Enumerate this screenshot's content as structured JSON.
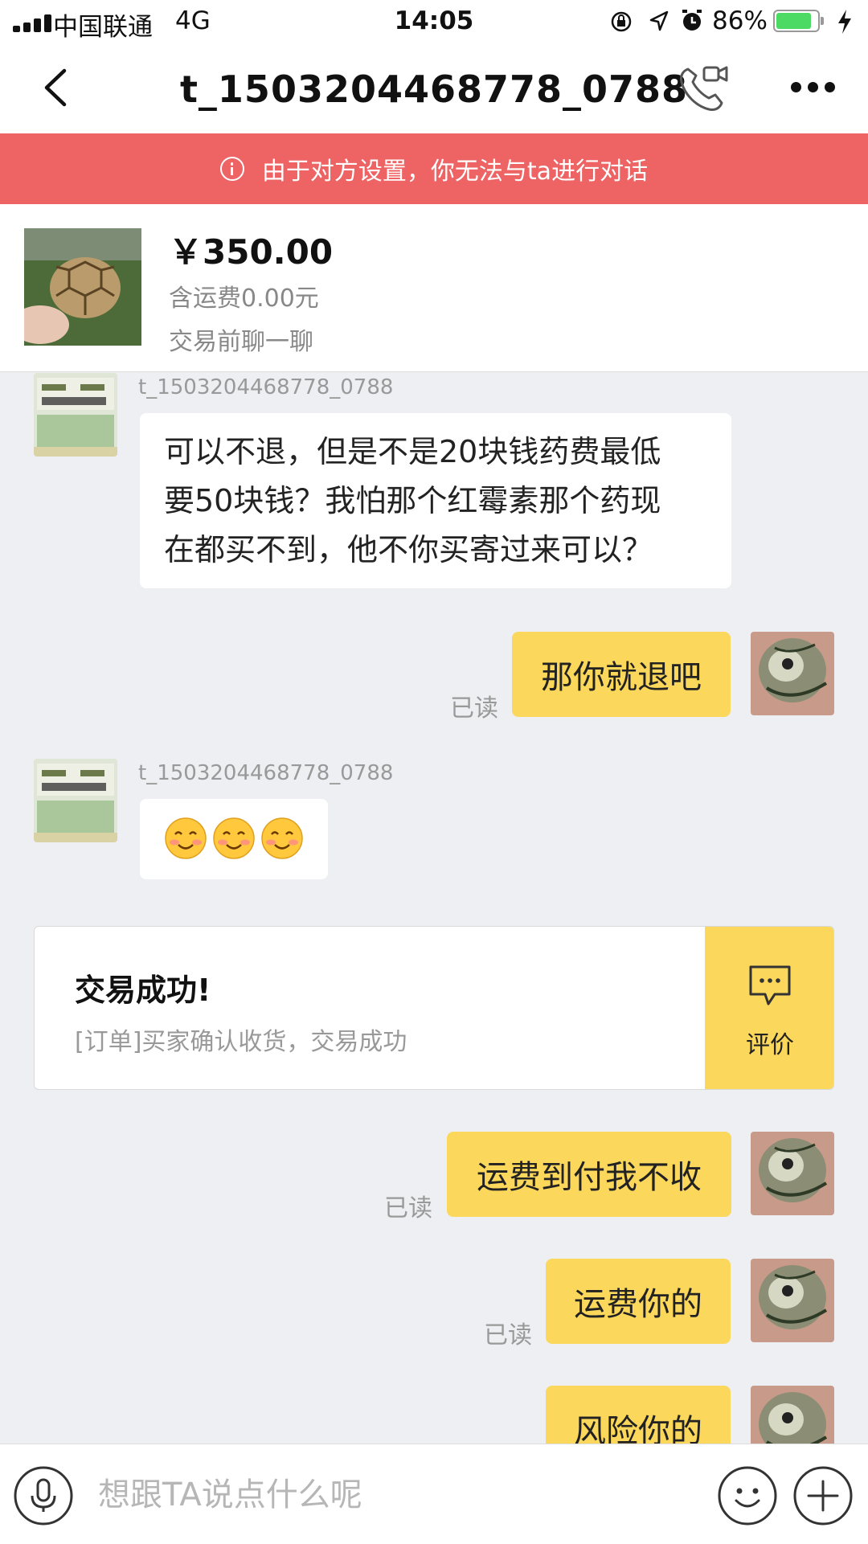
{
  "status_bar": {
    "carrier": "中国联通",
    "network": "4G",
    "time": "14:05",
    "battery_percent": "86%",
    "battery_level": 0.86,
    "battery_color": "#4cd964"
  },
  "nav": {
    "title": "t_1503204468778_0788",
    "icons": [
      "back-chevron-icon",
      "phone-video-call-icon",
      "more-icon"
    ]
  },
  "banner": {
    "text": "由于对方设置，你无法与ta进行对话",
    "color": "#ee6363"
  },
  "product": {
    "price": "￥350.00",
    "shipping": "含运费0.00元",
    "tag": "交易前聊一聊"
  },
  "messages": [
    {
      "direction": "in",
      "sender": "t_1503204468778_0788",
      "lines": [
        "可以不退，但是不是20块钱药费最低",
        "要50块钱？我怕那个红霉素那个药现",
        "在都买不到，他不你买寄过来可以？"
      ]
    },
    {
      "direction": "out",
      "text": "那你就退吧",
      "read": "已读"
    },
    {
      "direction": "in",
      "sender": "t_1503204468778_0788",
      "emoji": [
        "smiling-face-emoji",
        "smiling-face-emoji",
        "smiling-face-emoji"
      ]
    },
    {
      "direction": "out",
      "text": "运费到付我不收",
      "read": "已读"
    },
    {
      "direction": "out",
      "text": "运费你的",
      "read": "已读"
    },
    {
      "direction": "out",
      "text": "风险你的"
    }
  ],
  "order_card": {
    "title": "交易成功!",
    "description": "[订单]买家确认收货，交易成功",
    "action_label": "评价",
    "accent": "#fbd75b"
  },
  "input_bar": {
    "placeholder": "想跟TA说点什么呢",
    "value": ""
  }
}
